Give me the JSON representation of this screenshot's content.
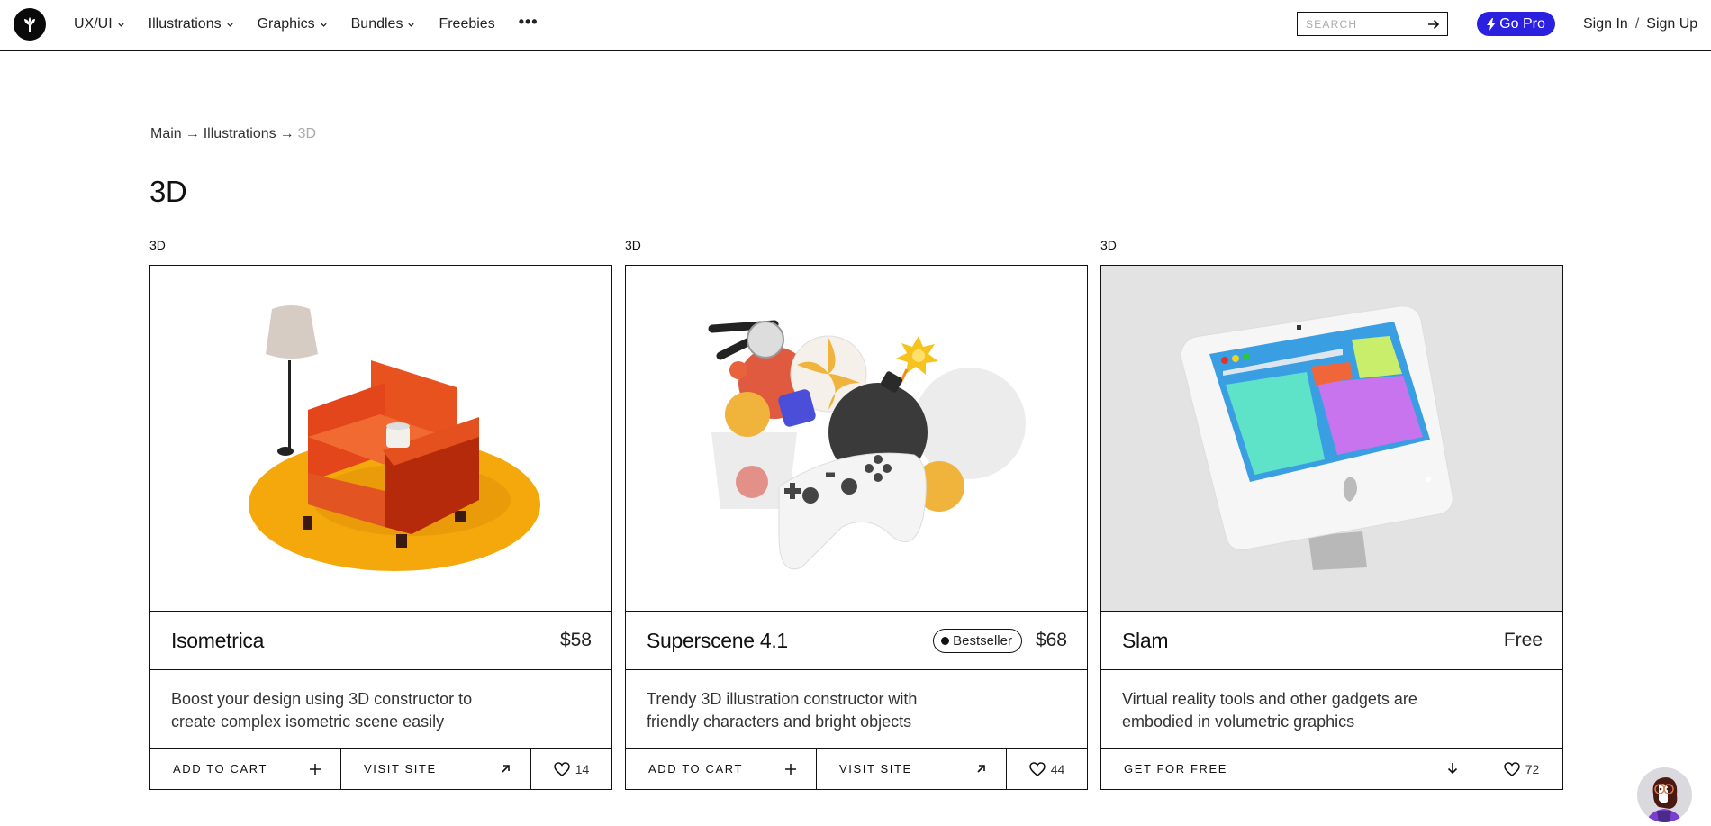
{
  "header": {
    "logo_icon": "sprout-leaf-icon",
    "nav": [
      {
        "label": "UX/UI",
        "has_dropdown": true
      },
      {
        "label": "Illustrations",
        "has_dropdown": true
      },
      {
        "label": "Graphics",
        "has_dropdown": true
      },
      {
        "label": "Bundles",
        "has_dropdown": true
      },
      {
        "label": "Freebies",
        "has_dropdown": false
      }
    ],
    "more_label": "•••",
    "search": {
      "placeholder": "SEARCH",
      "value": ""
    },
    "go_pro_label": "Go Pro",
    "sign_in_label": "Sign In",
    "auth_separator": "/",
    "sign_up_label": "Sign Up",
    "accent_color": "#2b1fe0"
  },
  "breadcrumb": {
    "items": [
      "Main",
      "Illustrations"
    ],
    "separator": "→",
    "current": "3D"
  },
  "page_title": "3D",
  "cards": [
    {
      "tag": "3D",
      "title": "Isometrica",
      "badge": null,
      "price": "$58",
      "description_line1": "Boost your design using 3D constructor to",
      "description_line2": "create complex isometric scene easily",
      "image": "orange armchair with floor lamp and mug on round yellow rug",
      "actions": {
        "primary_label": "ADD TO CART",
        "primary_icon": "plus-icon",
        "secondary_label": "VISIT SITE",
        "secondary_icon": "arrow-up-right-icon"
      },
      "likes": "14"
    },
    {
      "tag": "3D",
      "title": "Superscene 4.1",
      "badge": "Bestseller",
      "price": "$68",
      "description_line1": "Trendy 3D illustration constructor with",
      "description_line2": "friendly characters and bright objects",
      "image": "cluster of 3D objects: game controller, bomb, candy, fire extinguisher, glass",
      "actions": {
        "primary_label": "ADD TO CART",
        "primary_icon": "plus-icon",
        "secondary_label": "VISIT SITE",
        "secondary_icon": "arrow-up-right-icon"
      },
      "likes": "44"
    },
    {
      "tag": "3D",
      "title": "Slam",
      "badge": null,
      "price": "Free",
      "description_line1": "Virtual reality tools and other gadgets are",
      "description_line2": "embodied in volumetric graphics",
      "image": "white 3D computer monitor with colorful UI blocks on grey background",
      "actions": {
        "primary_label": "GET FOR FREE",
        "primary_icon": "arrow-down-icon"
      },
      "likes": "72"
    }
  ],
  "chat_avatar": "support-avatar-woman-glasses"
}
